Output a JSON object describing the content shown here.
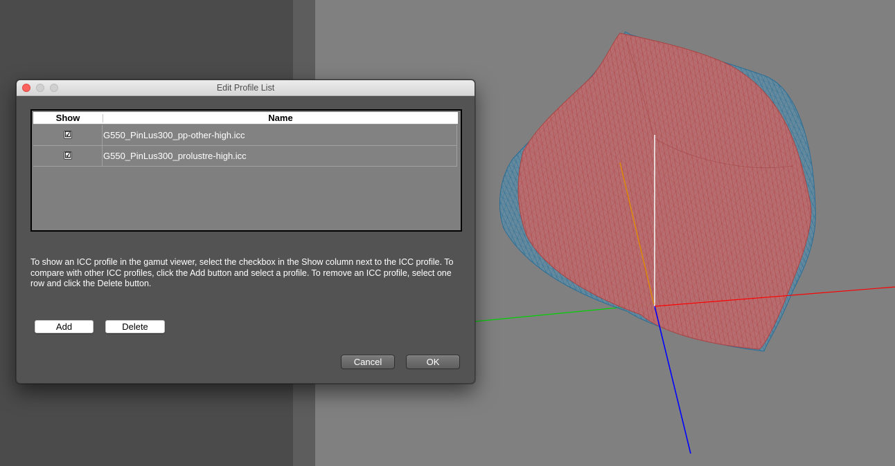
{
  "window": {
    "title": "Edit Profile List"
  },
  "table": {
    "columns": [
      "Show",
      "Name"
    ],
    "rows": [
      {
        "show": "☑",
        "name": "G550_PinLus300_pp-other-high.icc"
      },
      {
        "show": "☑",
        "name": "G550_PinLus300_prolustre-high.icc"
      }
    ]
  },
  "instructions": "To show an ICC profile in the gamut viewer, select the checkbox in the Show column next to the ICC profile. To compare with other ICC profiles, click the Add button and select a profile. To remove an ICC profile, select one row and click the Delete button.",
  "buttons": {
    "add": "Add",
    "delete": "Delete",
    "cancel": "Cancel",
    "ok": "OK"
  },
  "icons": {
    "close": "close-traffic-light-icon",
    "minimize": "minimize-traffic-light-icon",
    "maximize": "maximize-traffic-light-icon"
  },
  "colors": {
    "close_button": "#fc615d",
    "gamut_red": "#c25a5a",
    "gamut_blue": "#3a8ab8",
    "axis_red": "#ff0000",
    "axis_green": "#00d000",
    "axis_blue": "#0000ff",
    "axis_orange": "#e08a00"
  }
}
